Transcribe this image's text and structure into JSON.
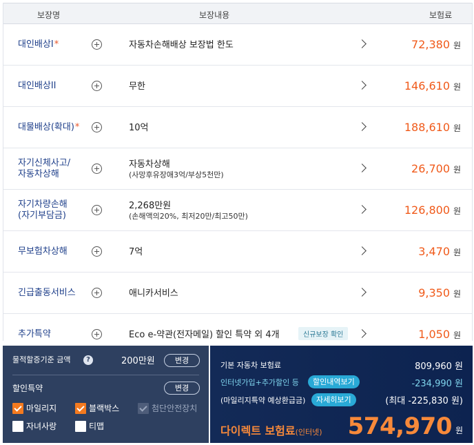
{
  "table": {
    "headers": {
      "name": "보장명",
      "detail": "보장내용",
      "premium": "보험료"
    },
    "currency_unit": "원",
    "rows": [
      {
        "name": "대인배상I",
        "required": "*",
        "main": "자동차손해배상 보장법 한도",
        "sub": "",
        "badge": "",
        "amount": "72,380"
      },
      {
        "name": "대인배상II",
        "required": "",
        "main": "무한",
        "sub": "",
        "badge": "",
        "amount": "146,610"
      },
      {
        "name": "대물배상(확대)",
        "required": "*",
        "main": "10억",
        "sub": "",
        "badge": "",
        "amount": "188,610"
      },
      {
        "name_lines": [
          "자기신체사고/",
          "자동차상해"
        ],
        "required": "",
        "main": "자동차상해",
        "sub": "(사망후유장애3억/부상5천만)",
        "badge": "",
        "amount": "26,700"
      },
      {
        "name_lines": [
          "자기차량손해",
          "(자기부담금)"
        ],
        "required": "",
        "main": "2,268만원",
        "sub": "(손해액의20%, 최저20만/최고50만)",
        "badge": "",
        "amount": "126,800"
      },
      {
        "name": "무보험차상해",
        "required": "",
        "main": "7억",
        "sub": "",
        "badge": "",
        "amount": "3,470"
      },
      {
        "name": "긴급출동서비스",
        "required": "",
        "main": "애니카서비스",
        "sub": "",
        "badge": "",
        "amount": "9,350"
      },
      {
        "name": "추가특약",
        "required": "",
        "main": "Eco e-약관(전자메일) 할인 특약 외 4개",
        "sub": "",
        "badge": "신규보장 확인",
        "amount": "1,050"
      }
    ]
  },
  "left_panel": {
    "base_label": "물적할증기준 금액",
    "base_amount": "200만원",
    "change_label": "변경",
    "discount_title": "할인특약",
    "discount_change_label": "변경",
    "options": [
      {
        "label": "마일리지",
        "state": "checked"
      },
      {
        "label": "블랙박스",
        "state": "checked"
      },
      {
        "label": "첨단안전장치",
        "state": "disabled"
      },
      {
        "label": "자녀사랑",
        "state": "unchecked"
      },
      {
        "label": "티맵",
        "state": "unchecked"
      }
    ]
  },
  "right_panel": {
    "base_label": "기본 자동차 보험료",
    "base_value": "809,960 원",
    "discount_label": "인터넷가입+추가할인 등",
    "discount_chip": "할인내역보기",
    "discount_value": "-234,990 원",
    "mileage_label": "(마일리지특약 예상환급금)",
    "mileage_chip": "자세히보기",
    "mileage_value": "(최대 -225,830 원)",
    "total_label": "다이렉트 보험료",
    "total_label_suffix": "(인터넷)",
    "total_value": "574,970",
    "total_unit": "원"
  },
  "colors": {
    "accent_orange": "#f05a1a",
    "navy": "#132a57",
    "cyan": "#7fd4ec",
    "name_blue": "#1e3f8a"
  }
}
